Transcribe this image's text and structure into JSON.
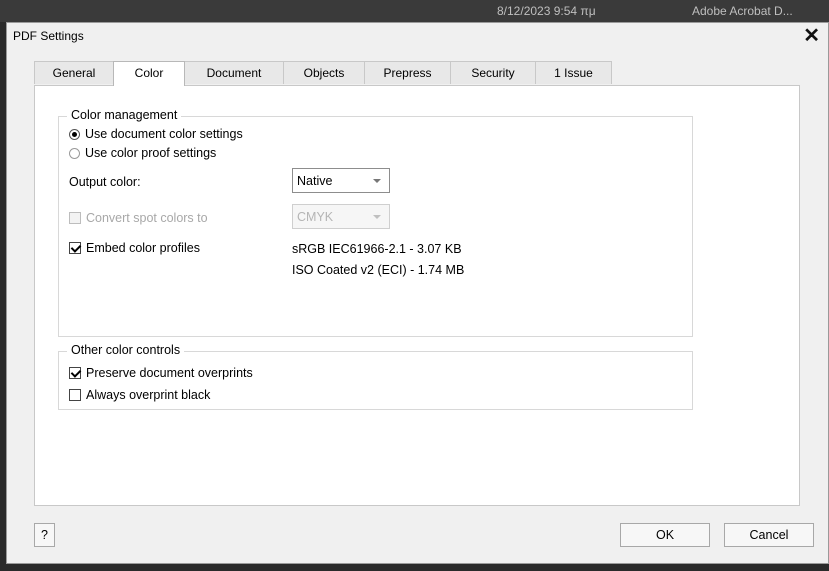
{
  "background": {
    "datetime": "8/12/2023 9:54 πμ",
    "app_title": "Adobe Acrobat D..."
  },
  "dialog": {
    "title": "PDF Settings"
  },
  "tabs": [
    {
      "label": "General",
      "active": false
    },
    {
      "label": "Color",
      "active": true
    },
    {
      "label": "Document",
      "active": false
    },
    {
      "label": "Objects",
      "active": false
    },
    {
      "label": "Prepress",
      "active": false
    },
    {
      "label": "Security",
      "active": false
    },
    {
      "label": "1 Issue",
      "active": false
    }
  ],
  "color_management": {
    "title": "Color management",
    "use_document_settings": "Use document color settings",
    "use_proof_settings": "Use color proof settings",
    "output_color_label": "Output color:",
    "output_color_value": "Native",
    "convert_spot_label": "Convert spot colors to",
    "convert_spot_value": "CMYK",
    "embed_profiles_label": "Embed color profiles",
    "profile_1": "sRGB IEC61966-2.1 - 3.07 KB",
    "profile_2": "ISO Coated v2 (ECI) - 1.74 MB"
  },
  "other_controls": {
    "title": "Other color controls",
    "preserve_overprints": "Preserve document overprints",
    "overprint_black": "Always overprint black"
  },
  "buttons": {
    "help": "?",
    "ok": "OK",
    "cancel": "Cancel"
  },
  "icons": {
    "close": "close-icon",
    "dropdown": "chevron-down-icon"
  }
}
